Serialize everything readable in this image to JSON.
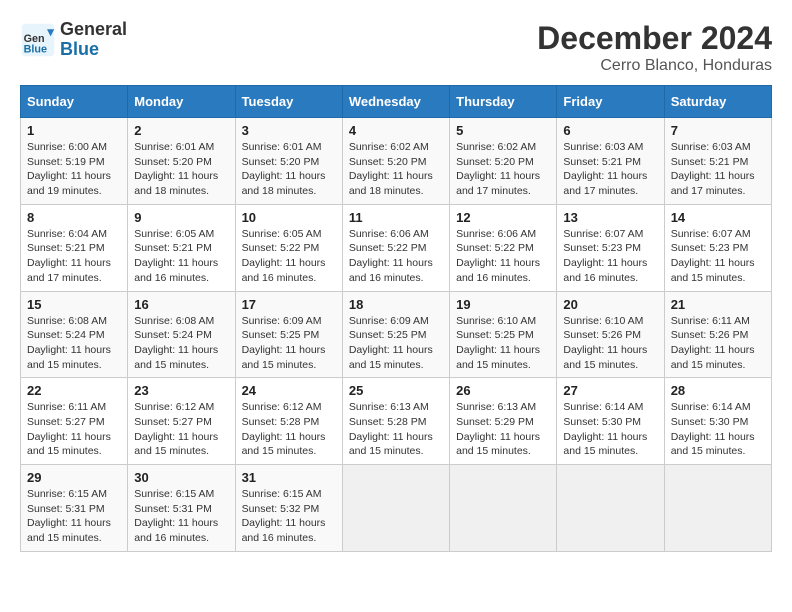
{
  "header": {
    "logo_general": "General",
    "logo_blue": "Blue",
    "title": "December 2024",
    "subtitle": "Cerro Blanco, Honduras"
  },
  "calendar": {
    "days_of_week": [
      "Sunday",
      "Monday",
      "Tuesday",
      "Wednesday",
      "Thursday",
      "Friday",
      "Saturday"
    ],
    "weeks": [
      [
        {
          "day": "1",
          "info": "Sunrise: 6:00 AM\nSunset: 5:19 PM\nDaylight: 11 hours\nand 19 minutes."
        },
        {
          "day": "2",
          "info": "Sunrise: 6:01 AM\nSunset: 5:20 PM\nDaylight: 11 hours\nand 18 minutes."
        },
        {
          "day": "3",
          "info": "Sunrise: 6:01 AM\nSunset: 5:20 PM\nDaylight: 11 hours\nand 18 minutes."
        },
        {
          "day": "4",
          "info": "Sunrise: 6:02 AM\nSunset: 5:20 PM\nDaylight: 11 hours\nand 18 minutes."
        },
        {
          "day": "5",
          "info": "Sunrise: 6:02 AM\nSunset: 5:20 PM\nDaylight: 11 hours\nand 17 minutes."
        },
        {
          "day": "6",
          "info": "Sunrise: 6:03 AM\nSunset: 5:21 PM\nDaylight: 11 hours\nand 17 minutes."
        },
        {
          "day": "7",
          "info": "Sunrise: 6:03 AM\nSunset: 5:21 PM\nDaylight: 11 hours\nand 17 minutes."
        }
      ],
      [
        {
          "day": "8",
          "info": "Sunrise: 6:04 AM\nSunset: 5:21 PM\nDaylight: 11 hours\nand 17 minutes."
        },
        {
          "day": "9",
          "info": "Sunrise: 6:05 AM\nSunset: 5:21 PM\nDaylight: 11 hours\nand 16 minutes."
        },
        {
          "day": "10",
          "info": "Sunrise: 6:05 AM\nSunset: 5:22 PM\nDaylight: 11 hours\nand 16 minutes."
        },
        {
          "day": "11",
          "info": "Sunrise: 6:06 AM\nSunset: 5:22 PM\nDaylight: 11 hours\nand 16 minutes."
        },
        {
          "day": "12",
          "info": "Sunrise: 6:06 AM\nSunset: 5:22 PM\nDaylight: 11 hours\nand 16 minutes."
        },
        {
          "day": "13",
          "info": "Sunrise: 6:07 AM\nSunset: 5:23 PM\nDaylight: 11 hours\nand 16 minutes."
        },
        {
          "day": "14",
          "info": "Sunrise: 6:07 AM\nSunset: 5:23 PM\nDaylight: 11 hours\nand 15 minutes."
        }
      ],
      [
        {
          "day": "15",
          "info": "Sunrise: 6:08 AM\nSunset: 5:24 PM\nDaylight: 11 hours\nand 15 minutes."
        },
        {
          "day": "16",
          "info": "Sunrise: 6:08 AM\nSunset: 5:24 PM\nDaylight: 11 hours\nand 15 minutes."
        },
        {
          "day": "17",
          "info": "Sunrise: 6:09 AM\nSunset: 5:25 PM\nDaylight: 11 hours\nand 15 minutes."
        },
        {
          "day": "18",
          "info": "Sunrise: 6:09 AM\nSunset: 5:25 PM\nDaylight: 11 hours\nand 15 minutes."
        },
        {
          "day": "19",
          "info": "Sunrise: 6:10 AM\nSunset: 5:25 PM\nDaylight: 11 hours\nand 15 minutes."
        },
        {
          "day": "20",
          "info": "Sunrise: 6:10 AM\nSunset: 5:26 PM\nDaylight: 11 hours\nand 15 minutes."
        },
        {
          "day": "21",
          "info": "Sunrise: 6:11 AM\nSunset: 5:26 PM\nDaylight: 11 hours\nand 15 minutes."
        }
      ],
      [
        {
          "day": "22",
          "info": "Sunrise: 6:11 AM\nSunset: 5:27 PM\nDaylight: 11 hours\nand 15 minutes."
        },
        {
          "day": "23",
          "info": "Sunrise: 6:12 AM\nSunset: 5:27 PM\nDaylight: 11 hours\nand 15 minutes."
        },
        {
          "day": "24",
          "info": "Sunrise: 6:12 AM\nSunset: 5:28 PM\nDaylight: 11 hours\nand 15 minutes."
        },
        {
          "day": "25",
          "info": "Sunrise: 6:13 AM\nSunset: 5:28 PM\nDaylight: 11 hours\nand 15 minutes."
        },
        {
          "day": "26",
          "info": "Sunrise: 6:13 AM\nSunset: 5:29 PM\nDaylight: 11 hours\nand 15 minutes."
        },
        {
          "day": "27",
          "info": "Sunrise: 6:14 AM\nSunset: 5:30 PM\nDaylight: 11 hours\nand 15 minutes."
        },
        {
          "day": "28",
          "info": "Sunrise: 6:14 AM\nSunset: 5:30 PM\nDaylight: 11 hours\nand 15 minutes."
        }
      ],
      [
        {
          "day": "29",
          "info": "Sunrise: 6:15 AM\nSunset: 5:31 PM\nDaylight: 11 hours\nand 15 minutes."
        },
        {
          "day": "30",
          "info": "Sunrise: 6:15 AM\nSunset: 5:31 PM\nDaylight: 11 hours\nand 16 minutes."
        },
        {
          "day": "31",
          "info": "Sunrise: 6:15 AM\nSunset: 5:32 PM\nDaylight: 11 hours\nand 16 minutes."
        },
        {
          "day": "",
          "info": ""
        },
        {
          "day": "",
          "info": ""
        },
        {
          "day": "",
          "info": ""
        },
        {
          "day": "",
          "info": ""
        }
      ]
    ]
  }
}
